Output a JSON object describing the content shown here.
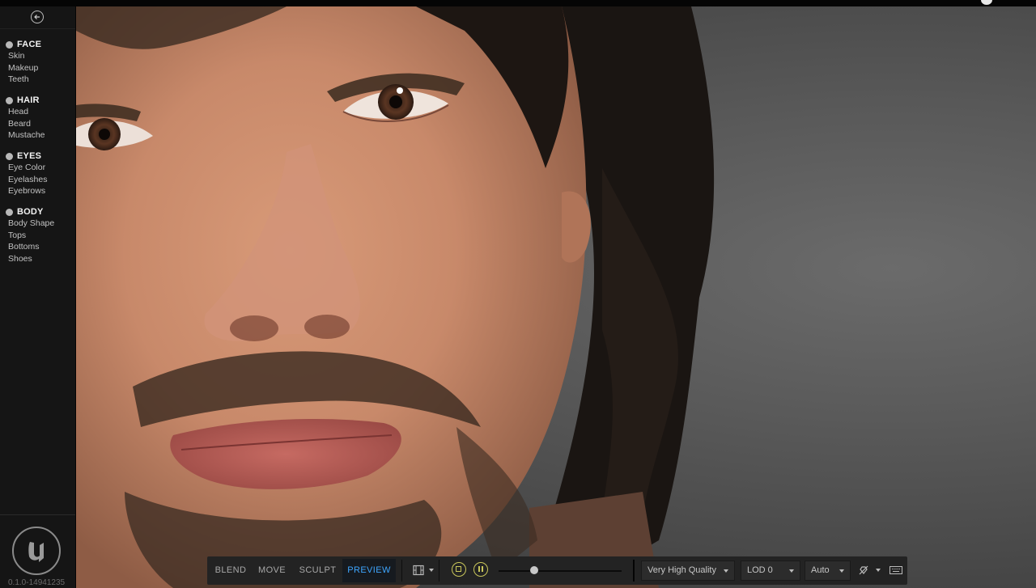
{
  "sidebar": {
    "sections": [
      {
        "title": "FACE",
        "items": [
          "Skin",
          "Makeup",
          "Teeth"
        ]
      },
      {
        "title": "HAIR",
        "items": [
          "Head",
          "Beard",
          "Mustache"
        ]
      },
      {
        "title": "EYES",
        "items": [
          "Eye Color",
          "Eyelashes",
          "Eyebrows"
        ]
      },
      {
        "title": "BODY",
        "items": [
          "Body Shape",
          "Tops",
          "Bottoms",
          "Shoes"
        ]
      }
    ],
    "version": "0.1.0-14941235"
  },
  "toolbar": {
    "modes": [
      "BLEND",
      "MOVE",
      "SCULPT",
      "PREVIEW"
    ],
    "active_mode": "PREVIEW",
    "timeline_position": 0.29,
    "quality": "Very High Quality",
    "lod": "LOD 0",
    "auto": "Auto"
  },
  "colors": {
    "accent": "#3ea6ff",
    "playback": "#c9c65a",
    "sidebar_bg": "#151515"
  },
  "icons": [
    "back-arrow-icon",
    "face-icon",
    "hair-icon",
    "eyes-icon",
    "body-icon",
    "unreal-logo-icon",
    "camera-icon",
    "stop-icon",
    "pause-icon",
    "lighting-icon",
    "keyboard-icon"
  ]
}
